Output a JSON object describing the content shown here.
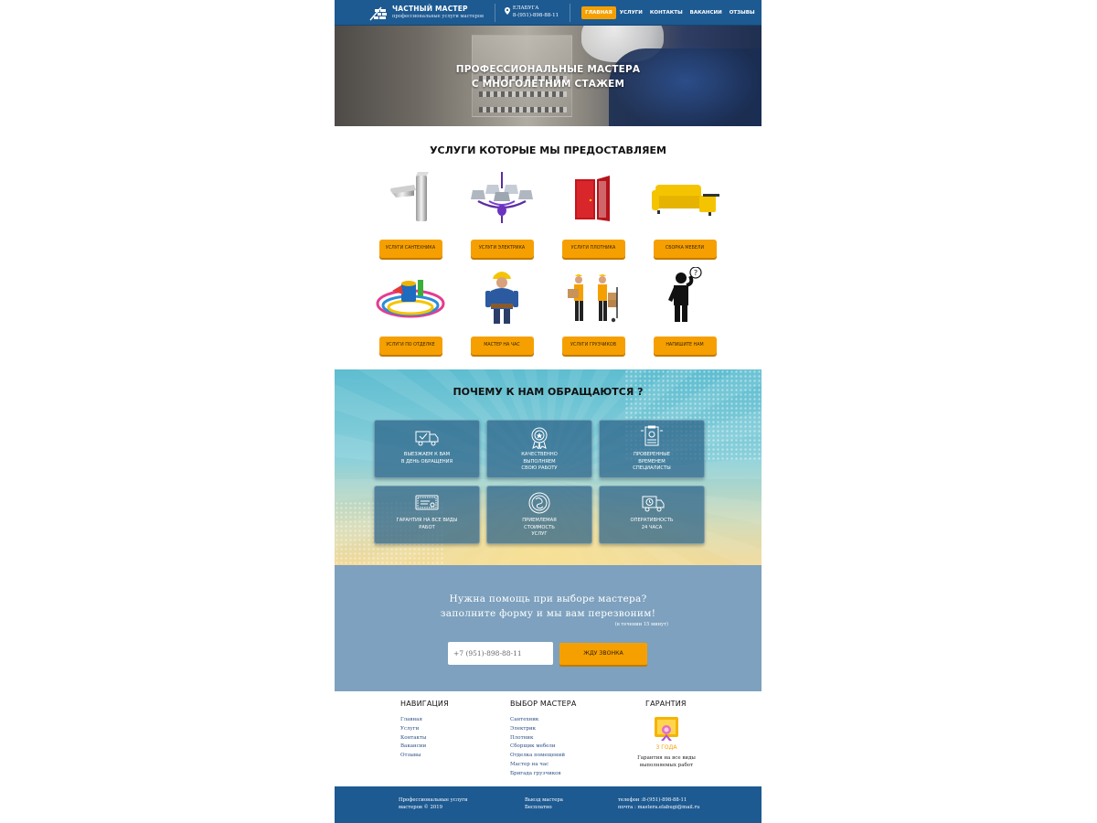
{
  "header": {
    "brand_name": "ЧАСТНЫЙ МАСТЕР",
    "brand_sub": "профессиональные услуги мастеров",
    "city": "ЕЛАБУГА",
    "phone": "8-(951)-898-88-11",
    "nav": [
      "ГЛАВНАЯ",
      "УСЛУГИ",
      "КОНТАКТЫ",
      "ВАКАНСИИ",
      "ОТЗЫВЫ"
    ],
    "active_nav": "ГЛАВНАЯ"
  },
  "hero": {
    "title_line1": "ПРОФЕССИОНАЛЬНЫЕ МАСТЕРА",
    "title_line2": "С МНОГОЛЕТНИМ СТАЖЕМ"
  },
  "services": {
    "title": "УСЛУГИ КОТОРЫЕ МЫ ПРЕДОСТАВЛЯЕМ",
    "items": [
      {
        "label": "УСЛУГИ САНТЕХНИКА",
        "icon": "faucet-icon"
      },
      {
        "label": "УСЛУГИ ЭЛЕКТРИКА",
        "icon": "chandelier-icon"
      },
      {
        "label": "УСЛУГИ ПЛОТНИКА",
        "icon": "door-icon"
      },
      {
        "label": "СБОРКА МЕБЕЛИ",
        "icon": "sofa-icon"
      },
      {
        "label": "УСЛУГИ ПО ОТДЕЛКЕ",
        "icon": "paint-supplies-icon"
      },
      {
        "label": "МАСТЕР НА ЧАС",
        "icon": "handyman-icon"
      },
      {
        "label": "УСЛУГИ ГРУЗЧИКОВ",
        "icon": "movers-icon"
      },
      {
        "label": "НАПИШИТЕ НАМ",
        "icon": "question-person-icon"
      }
    ]
  },
  "why": {
    "title": "ПОЧЕМУ К НАМ ОБРАЩАЮТСЯ ?",
    "cards": [
      {
        "text": "ВЫЕЗЖАЕМ К ВАМ\nВ ДЕНЬ ОБРАЩЕНИЯ",
        "icon": "delivery-truck-icon"
      },
      {
        "text": "КАЧЕСТВЕННО\nВЫПОЛНЯЕМ\nСВОЮ РАБОТУ",
        "icon": "quality-badge-icon"
      },
      {
        "text": "ПРОВЕРЕННЫЕ\nВРЕМЕНЕМ\nСПЕЦИАЛИСТЫ",
        "icon": "certificate-icon"
      },
      {
        "text": "ГАРАНТИЯ НА ВСЕ ВИДЫ\nРАБОТ",
        "icon": "guarantee-icon"
      },
      {
        "text": "ПРИЕМЛЕМАЯ\nСТОИМОСТЬ\nУСЛУГ",
        "icon": "price-icon"
      },
      {
        "text": "ОПЕРАТИВНОСТЬ\n24 ЧАСА",
        "icon": "fast-delivery-icon"
      }
    ]
  },
  "callback": {
    "title_line1": "Нужна помощь при выборе мастера?",
    "title_line2": "заполните форму и мы вам перезвоним!",
    "note": "(в течении 15 минут)",
    "phone_value": "+7 (951)-898-88-11",
    "button_label": "ЖДУ ЗВОНКА"
  },
  "footer": {
    "nav_title": "НАВИГАЦИЯ",
    "nav_links": [
      "Главная",
      "Услуги",
      "Контакты",
      "Вакансии",
      "Отзывы"
    ],
    "masters_title": "ВЫБОР МАСТЕРА",
    "masters_links": [
      "Сантехник",
      "Электрик",
      "Плотник",
      "Сборщик мебели",
      "Отделка помещений",
      "Мастер на час",
      "Бригада грузчиков"
    ],
    "guarantee_title": "ГАРАНТИЯ",
    "guarantee_years": "3 ГОДА",
    "guarantee_text": "Гарантия на все виды\nвыполняемых работ"
  },
  "bottom": {
    "copyright": "Профессиональные услуги\nмастеров © 2019",
    "visit": "Выезд мастера\nБесплатно",
    "contacts": "телефон :8-(951)-898-88-11\nпочта : mastera.elabugi@mail.ru"
  },
  "colors": {
    "header_blue": "#1d5a92",
    "accent_orange": "#f5a000",
    "cta_blue": "#7da1be"
  }
}
